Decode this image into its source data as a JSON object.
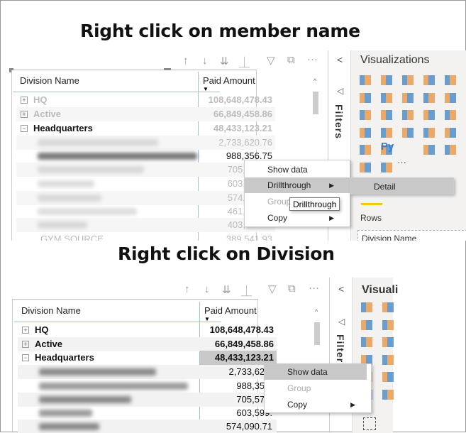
{
  "top": {
    "heading": "Right click on member name",
    "toolbar_icons": [
      "arrow-up-icon",
      "arrow-down-icon",
      "double-arrow-down-icon",
      "expand-hierarchy-icon",
      "filter-icon",
      "focus-mode-icon",
      "more-options-icon"
    ],
    "more": "···",
    "columns": [
      "Division Name",
      "Paid Amount"
    ],
    "rows": [
      {
        "label": "HQ",
        "value": "108,648,478.43",
        "expand": "+"
      },
      {
        "label": "Active",
        "value": "66,849,458.86",
        "expand": "+"
      },
      {
        "label": "Headquarters",
        "value": "48,433,123.21",
        "expand": "−"
      }
    ],
    "child_values": [
      "2,733,620.76",
      "988,356.75",
      "705,",
      "603,",
      "574,",
      "461,",
      "403,"
    ],
    "last_row": {
      "label": "GYM SOURCE",
      "value": "389,541.93"
    },
    "context_menu": [
      {
        "label": "Show data",
        "state": "normal"
      },
      {
        "label": "Drillthrough",
        "state": "highlighted",
        "submenu": true
      },
      {
        "label": "Group",
        "state": "disabled"
      },
      {
        "label": "Copy",
        "state": "normal",
        "submenu": true
      }
    ],
    "submenu_item": "Detail",
    "tooltip": "Drillthrough",
    "pane": {
      "collapse": "<",
      "filters_label": "Filters",
      "title": "Visualizations",
      "more": "···",
      "py_label": "Py",
      "rows_label": "Rows",
      "field_well": "Division Name"
    }
  },
  "bottom": {
    "heading": "Right click on Division",
    "more": "···",
    "columns": [
      "Division Name",
      "Paid Amount"
    ],
    "rows": [
      {
        "label": "HQ",
        "value": "108,648,478.43",
        "expand": "+"
      },
      {
        "label": "Active",
        "value": "66,849,458.86",
        "expand": "+"
      },
      {
        "label": "Headquarters",
        "value": "48,433,123.21",
        "expand": "−"
      }
    ],
    "child_values": [
      "2,733,620.",
      "988,356.",
      "705,575.",
      "603,599.",
      "574,090.71"
    ],
    "context_menu": [
      {
        "label": "Show data",
        "state": "highlighted"
      },
      {
        "label": "Group",
        "state": "disabled"
      },
      {
        "label": "Copy",
        "state": "normal",
        "submenu": true
      }
    ],
    "pane": {
      "collapse": "<",
      "filters_label": "Filters",
      "title": "Visuali"
    }
  },
  "colors": {
    "accent_line": "#9cc3e6",
    "highlight": "#c8c8c8",
    "viz_orange": "#e8913c",
    "viz_blue": "#3b7fc4",
    "active_tab": "#f2c811"
  }
}
